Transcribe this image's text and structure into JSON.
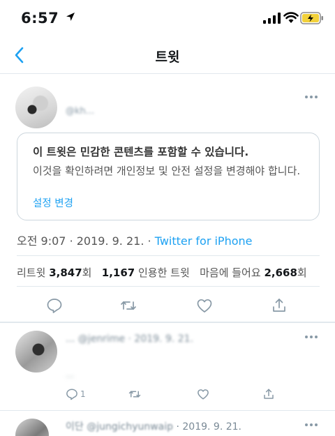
{
  "status_bar": {
    "time": "6:57"
  },
  "nav": {
    "title": "트윗"
  },
  "tweet": {
    "handle": "@kh...",
    "sensitive": {
      "title": "이 트윗은 민감한 콘텐츠를 포함할 수 있습니다.",
      "body": "이것을 확인하려면 개인정보 및 안전 설정을 변경해야 합니다.",
      "link": "설정 변경"
    },
    "meta": {
      "time": "오전 9:07",
      "date": "2019. 9. 21.",
      "source": "Twitter for iPhone"
    },
    "stats": {
      "retweets_label": "리트윗",
      "retweets": "3,847",
      "retweets_unit": "회",
      "quotes": "1,167",
      "quotes_label": "인용한 트윗",
      "likes_label": "마음에 들어요",
      "likes": "2,668",
      "likes_unit": "회"
    }
  },
  "replies": [
    {
      "header": "... @jenrime · 2019. 9. 21.",
      "body": "...",
      "reply_count": "1"
    },
    {
      "header_blurred": "이단 @jungichyunwaip",
      "date": "· 2019. 9. 21."
    }
  ],
  "colors": {
    "accent": "#1da1f2",
    "divider": "#e1e8ed",
    "text": "#14171a",
    "secondary": "#8899a6"
  }
}
